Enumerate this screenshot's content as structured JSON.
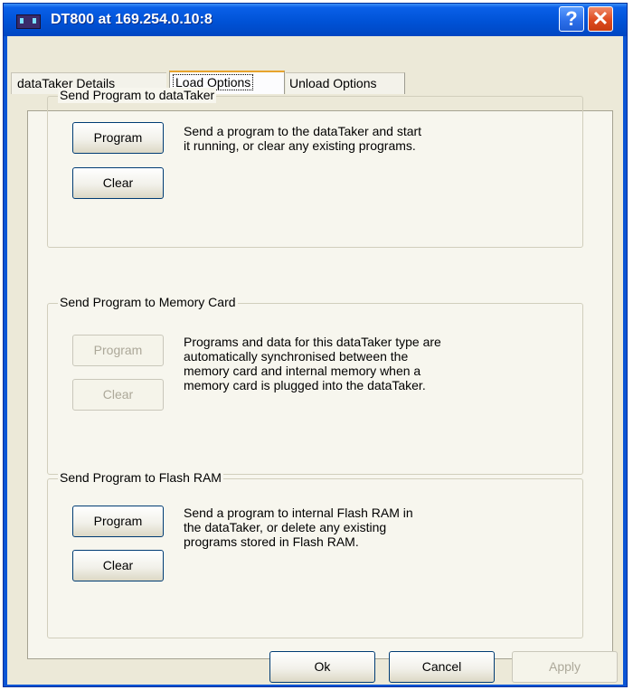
{
  "window": {
    "title": "DT800 at 169.254.0.10:8",
    "help_glyph": "?",
    "close_glyph": "✕"
  },
  "tabs": [
    {
      "label": "dataTaker Details",
      "selected": false
    },
    {
      "label": "Load Options",
      "selected": true
    },
    {
      "label": "Unload Options",
      "selected": false
    }
  ],
  "groups": {
    "datataker": {
      "label": "Send Program to dataTaker",
      "program_label": "Program",
      "clear_label": "Clear",
      "enabled": true,
      "description": "Send a program to the dataTaker and start\nit running, or clear any existing programs."
    },
    "memory": {
      "label": "Send Program to Memory Card",
      "program_label": "Program",
      "clear_label": "Clear",
      "enabled": false,
      "description": "Programs and data for this dataTaker type are\nautomatically synchronised between the\nmemory card and internal memory when a\nmemory card is plugged into the dataTaker."
    },
    "flash": {
      "label": "Send Program to Flash RAM",
      "program_label": "Program",
      "clear_label": "Clear",
      "enabled": true,
      "description": "Send a program to internal Flash RAM in\nthe dataTaker, or delete any existing\nprograms stored in Flash RAM."
    }
  },
  "footer": {
    "ok_label": "Ok",
    "cancel_label": "Cancel",
    "apply_label": "Apply",
    "apply_enabled": false
  },
  "colors": {
    "titlebar": "#0052d6",
    "dialog_face": "#ece9d8",
    "selected_tab_accent": "#e7a32d",
    "close_button": "#de4a1e"
  },
  "icons": {
    "app": "datataker-device-icon",
    "help": "help-icon",
    "close": "close-icon"
  }
}
